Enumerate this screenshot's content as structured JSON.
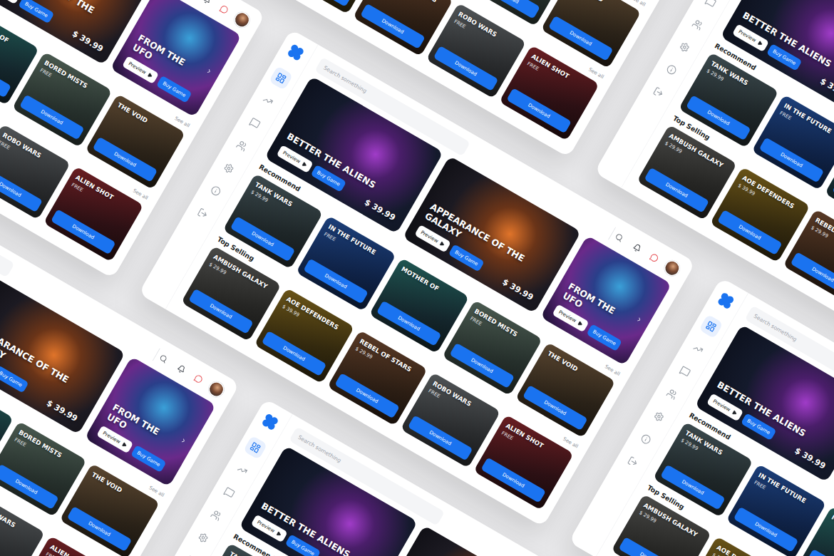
{
  "search": {
    "placeholder": "Search something"
  },
  "sidebar": {
    "items": [
      {
        "selected": true
      },
      {
        "selected": false
      },
      {
        "selected": false
      },
      {
        "selected": false
      },
      {
        "selected": false
      },
      {
        "selected": false
      },
      {
        "selected": false
      }
    ]
  },
  "hero": {
    "cards": [
      {
        "title": "BETTER THE ALIENS",
        "price": "$ 39.99",
        "preview": "Preview",
        "buy": "Buy Game",
        "has_next": false
      },
      {
        "title": "APPEARANCE OF THE GALAXY",
        "price": "$ 39.99",
        "preview": "Preview",
        "buy": "Buy Game",
        "has_next": false
      },
      {
        "title": "FROM THE UFO",
        "preview": "Preview",
        "buy": "Buy Game",
        "has_next": true
      }
    ]
  },
  "sections": [
    {
      "title": "Recommend",
      "see_all": "See all",
      "games": [
        {
          "title": "TANK WARS",
          "price": "$ 29.99",
          "action": "Download"
        },
        {
          "title": "IN THE FUTURE",
          "price": "FREE",
          "action": "Download"
        },
        {
          "title": "MOTHER OF",
          "action": "Download"
        },
        {
          "title": "BORED MISTS",
          "price": "FREE",
          "action": "Download"
        },
        {
          "title": "THE VOID",
          "action": "Download"
        }
      ]
    },
    {
      "title": "Top Selling",
      "see_all": "See all",
      "games": [
        {
          "title": "AMBUSH GALAXY",
          "price": "$ 29.99",
          "action": "Download"
        },
        {
          "title": "AOE DEFENDERS",
          "price": "$ 39.99",
          "action": "Download"
        },
        {
          "title": "REBEL OF STARS",
          "price": "$ 29.99",
          "action": "Download"
        },
        {
          "title": "ROBO WARS",
          "price": "FREE",
          "action": "Download"
        },
        {
          "title": "ALIEN SHOT",
          "price": "FREE",
          "action": "Download"
        }
      ]
    }
  ]
}
